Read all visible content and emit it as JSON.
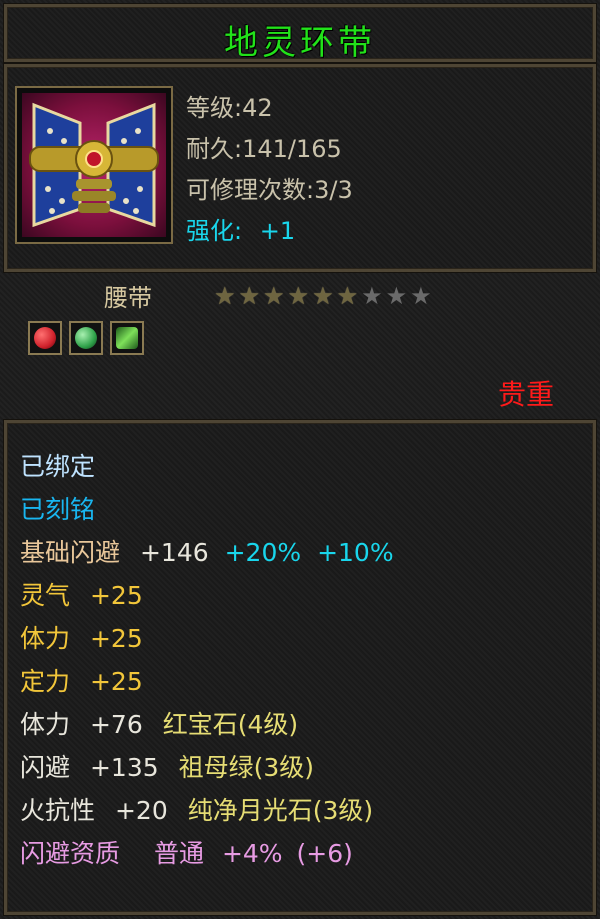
{
  "item": {
    "name": "地灵环带",
    "icon": "belt-item-icon",
    "level": "等级:42",
    "durability": "耐久:141/165",
    "repairs": "可修理次数:3/3",
    "enhance_label": "强化:",
    "enhance_value": "+1",
    "type": "腰带",
    "stars": {
      "filled": 6,
      "total": 9
    },
    "gems": [
      {
        "icon": "red-gem-icon",
        "color": "#d0222c"
      },
      {
        "icon": "green-gem-icon",
        "color": "#2fa24a"
      },
      {
        "icon": "moonstone-gem-icon",
        "color": "#5fcf3d"
      }
    ],
    "quality": "贵重"
  },
  "attributes": {
    "bound": "已绑定",
    "engraved": "已刻铭",
    "base_dodge": {
      "label": "基础闪避",
      "value": "+146",
      "pct1": "+20%",
      "pct2": "+10%"
    },
    "aura": {
      "label": "灵气",
      "value": "+25"
    },
    "stamina": {
      "label": "体力",
      "value": "+25"
    },
    "focus": {
      "label": "定力",
      "value": "+25"
    },
    "socket1": {
      "label": "体力",
      "value": "+76",
      "gem": "红宝石(4级)"
    },
    "socket2": {
      "label": "闪避",
      "value": "+135",
      "gem": "祖母绿(3级)"
    },
    "socket3": {
      "label": "火抗性",
      "value": "+20",
      "gem": "纯净月光石(3级)"
    },
    "aptitude": {
      "label": "闪避资质",
      "grade": "普通",
      "pct": "+4%",
      "bonus": "(+6)"
    }
  },
  "colors": {
    "title": "#22e21a",
    "quality": "#ff1a1a",
    "enhance": "#19d6ec",
    "aptitude": "#e79be3"
  }
}
